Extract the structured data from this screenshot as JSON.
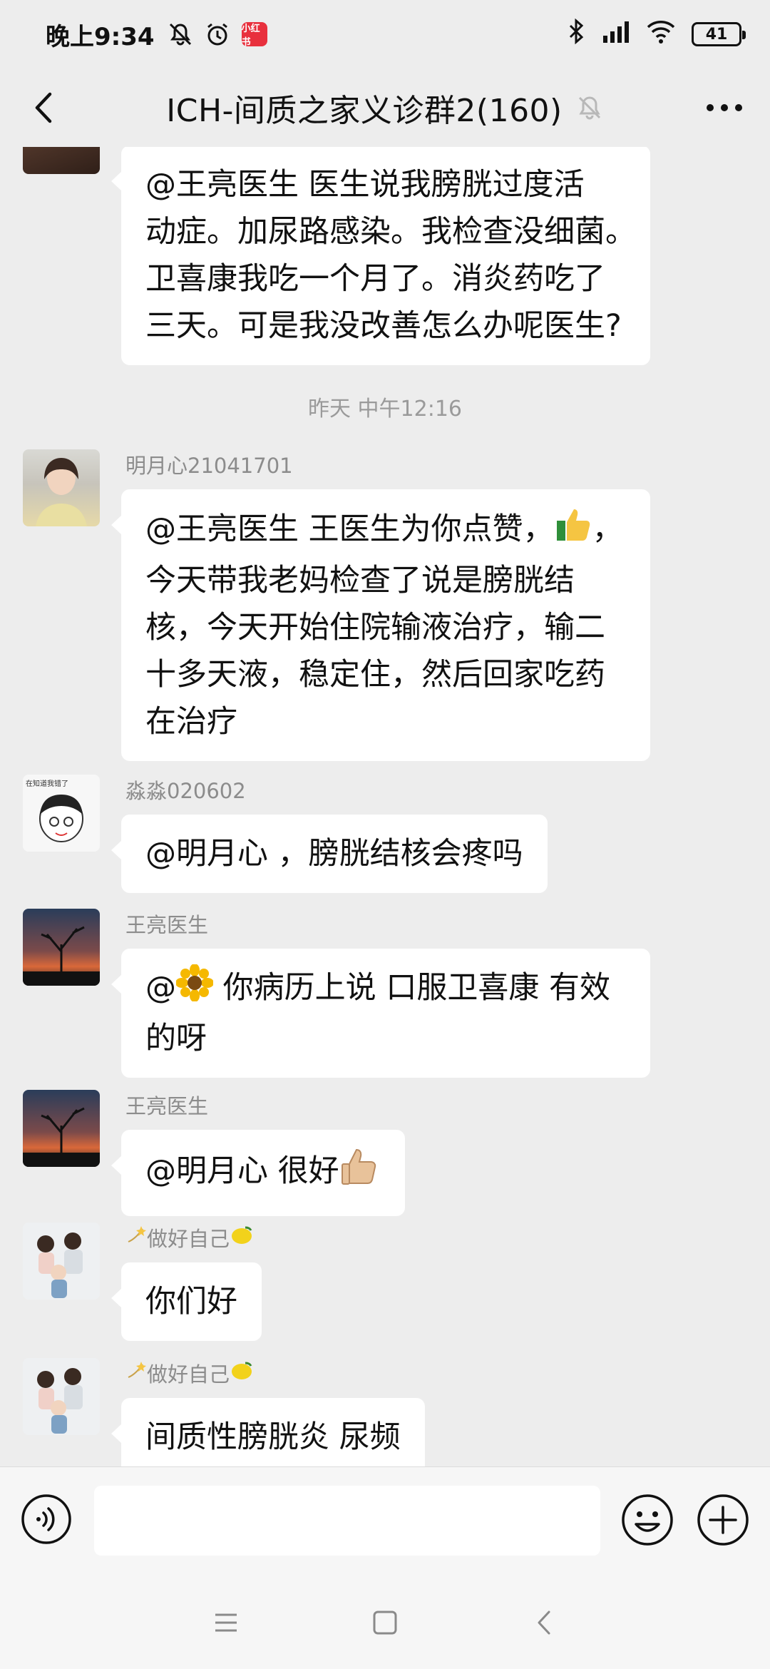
{
  "status_bar": {
    "time": "晚上9:34",
    "app_badge": "小红书",
    "battery": "41"
  },
  "header": {
    "title": "ICH-间质之家义诊群2(160)"
  },
  "messages": [
    {
      "sender": "",
      "lines": [
        "@王亮医生  医生说我膀胱过度活",
        "动症。加尿路感染。我检查没细菌。",
        "卫喜康我吃一个月了。消炎药吃了",
        "三天。可是我没改善怎么办呢医生?"
      ]
    },
    {
      "sender": "明月心21041701",
      "lines_a": "@王亮医生  王医生为你点赞，",
      "lines_a_end": "，",
      "lines": [
        "今天带我老妈检查了说是膀胱结",
        "核，今天开始住院输液治疗，输二",
        "十多天液，稳定住，然后回家吃药",
        "在治疗"
      ]
    },
    {
      "sender": "淼淼020602",
      "lines": [
        "@明月心 ，膀胱结核会疼吗"
      ]
    },
    {
      "sender": "王亮医生",
      "line_a_prefix": "@",
      "line_a_suffix": " 你病历上说 口服卫喜康 有效",
      "lines": [
        "的呀"
      ]
    },
    {
      "sender": "王亮医生",
      "lines": [
        "@明月心  很好"
      ]
    },
    {
      "sender": "做好自己",
      "lines": [
        "你们好"
      ]
    },
    {
      "sender": "做好自己",
      "lines": [
        "间质性膀胱炎 尿频"
      ]
    }
  ],
  "timestamp": "昨天 中午12:16",
  "input": {
    "placeholder": ""
  },
  "icons": {
    "back": "chevron-left-icon",
    "mute": "bell-off-icon",
    "more": "more-dots-icon",
    "voice": "voice-icon",
    "emoji": "smile-icon",
    "plus": "plus-icon"
  },
  "colors": {
    "background": "#ededed",
    "bubble": "#ffffff",
    "sender": "#8c8c8c"
  }
}
